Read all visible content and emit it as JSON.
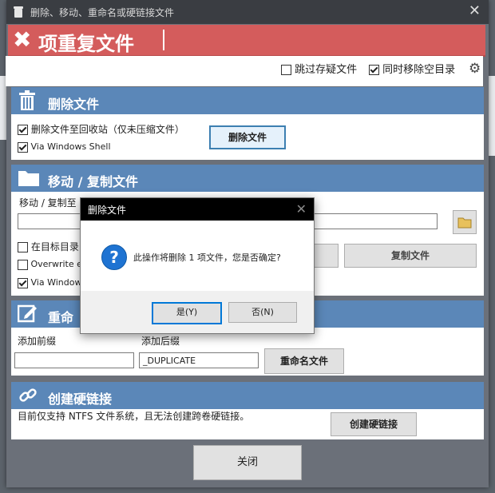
{
  "window": {
    "title": "删除、移动、重命名或硬链接文件",
    "close_glyph": "✕"
  },
  "banner": {
    "icon_glyph": "✖",
    "title": "项重复文件"
  },
  "options": {
    "skip_archive": {
      "label": "跳过存疑文件",
      "checked": false
    },
    "remove_empty": {
      "label": "同时移除空目录",
      "checked": true
    }
  },
  "delete_section": {
    "title": "删除文件",
    "recycle": {
      "label": "删除文件至回收站（仅未压缩文件）",
      "checked": true
    },
    "shell": {
      "label": "Via Windows Shell",
      "checked": true
    },
    "button": "删除文件"
  },
  "move_section": {
    "title": "移动 / 复制文件",
    "dest_label": "移动 / 复制至",
    "dest_value": "",
    "opt_target_dir": {
      "label": "在目标目录",
      "checked": false
    },
    "opt_overwrite": {
      "label": "Overwrite e",
      "checked": false
    },
    "opt_shell": {
      "label": "Via Window",
      "checked": true
    },
    "move_button": "",
    "copy_button": "复制文件"
  },
  "rename_section": {
    "title": "重命",
    "prefix_label": "添加前缀",
    "prefix_value": "",
    "suffix_label": "添加后缀",
    "suffix_value": "_DUPLICATE",
    "button": "重命名文件"
  },
  "hardlink_section": {
    "title": "创建硬链接",
    "note": "目前仅支持 NTFS 文件系统，且无法创建跨卷硬链接。",
    "button": "创建硬链接"
  },
  "close_button": "关闭",
  "dialog": {
    "title": "删除文件",
    "close_glyph": "✕",
    "icon_glyph": "?",
    "message": "此操作将删除 1 项文件，您是否确定?",
    "yes": "是(Y)",
    "no": "否(N)"
  },
  "colors": {
    "banner": "#d45c5c",
    "section": "#5b87b8",
    "titlebar": "#3a3d42"
  }
}
